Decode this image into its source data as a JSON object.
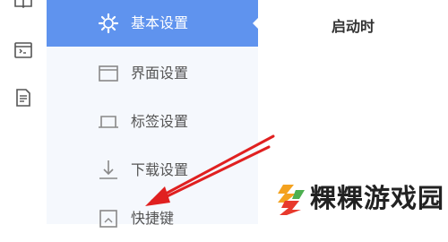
{
  "left_rail": {
    "icons": [
      "book-icon",
      "terminal-icon",
      "document-icon"
    ]
  },
  "settings_nav": {
    "active_index": 0,
    "items": [
      {
        "label": "基本设置",
        "icon": "gear-icon"
      },
      {
        "label": "界面设置",
        "icon": "window-icon"
      },
      {
        "label": "标签设置",
        "icon": "tab-icon"
      },
      {
        "label": "下载设置",
        "icon": "download-icon"
      },
      {
        "label": "快捷键",
        "icon": "keyboard-icon"
      }
    ]
  },
  "content": {
    "section_heading": "启动时"
  },
  "annotation": {
    "type": "arrow",
    "color": "#e02020"
  },
  "watermark": {
    "text": "粿粿游戏园"
  },
  "colors": {
    "accent": "#5f93ee",
    "nav_background": "#f5f8fd",
    "annotation_red": "#e02020"
  }
}
